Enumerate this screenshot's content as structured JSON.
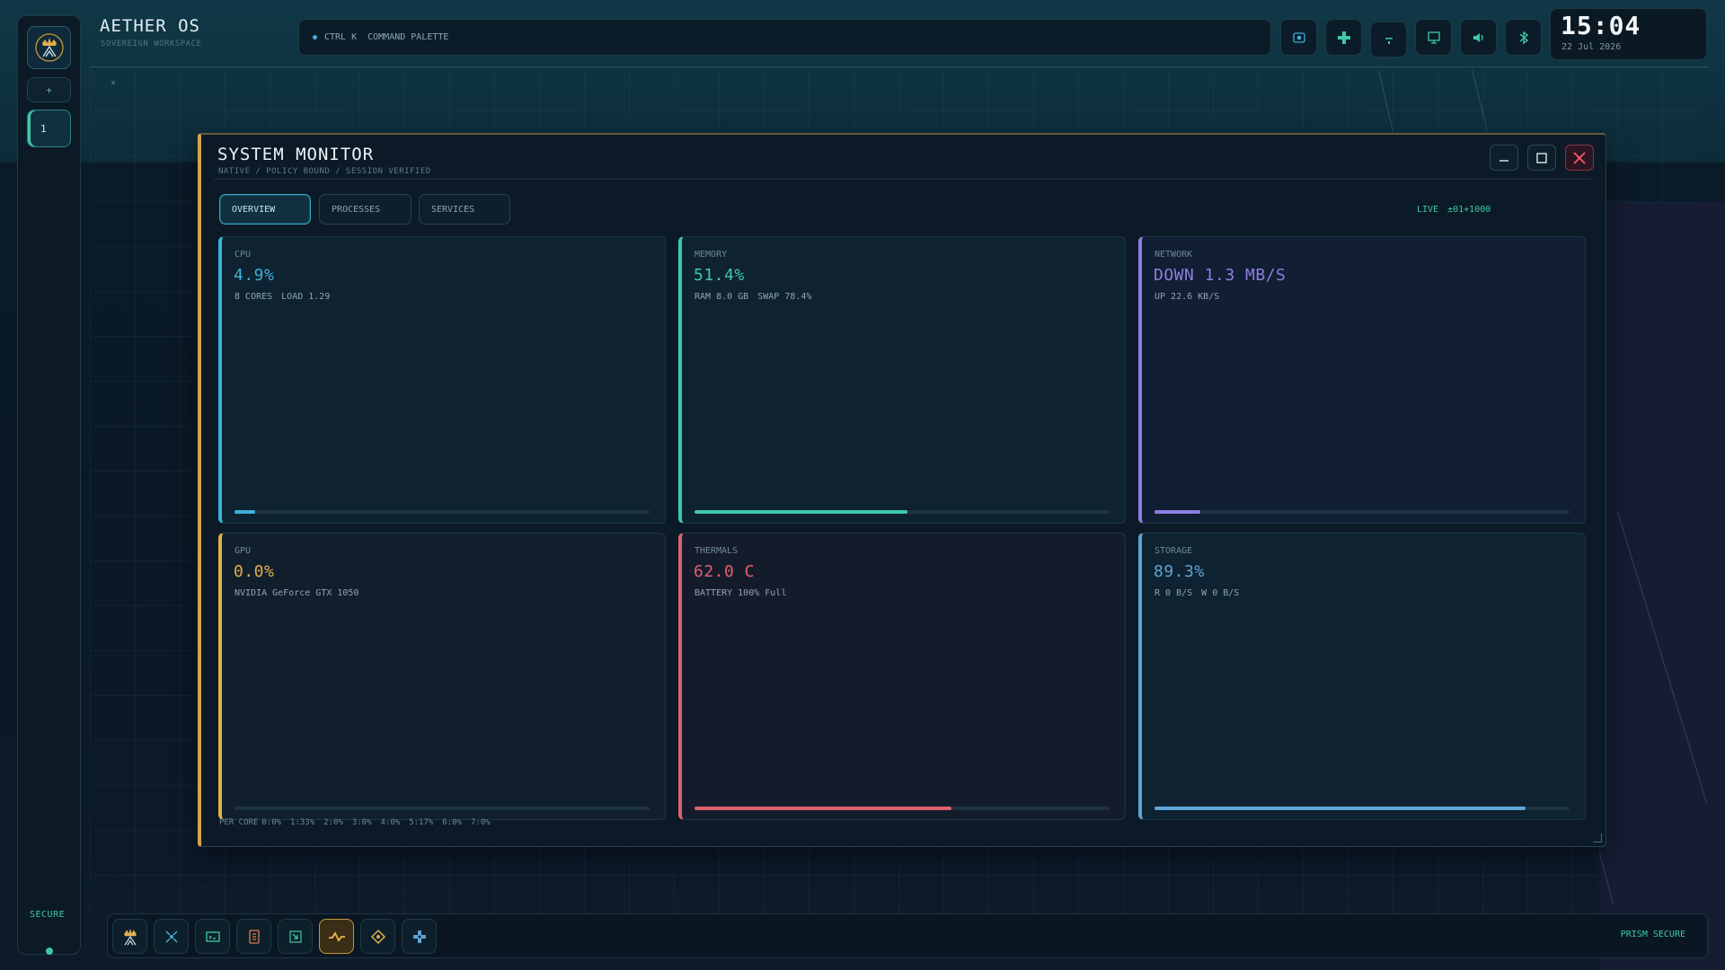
{
  "brand": {
    "title": "AETHER OS",
    "subtitle": "SOVEREIGN WORKSPACE"
  },
  "rail": {
    "add_label": "+",
    "workspace_label": "1",
    "secure_label": "SECURE"
  },
  "palette": {
    "shortcut": "CTRL K",
    "label": "COMMAND PALETTE"
  },
  "tray": {
    "icons": [
      "screenshot-icon",
      "gamepad-icon",
      "pin-icon",
      "display-icon",
      "volume-icon",
      "bluetooth-icon"
    ]
  },
  "clock": {
    "time": "15:04",
    "date": "22 Jul 2026"
  },
  "window": {
    "title": "SYSTEM MONITOR",
    "breadcrumb": "NATIVE  /  POLICY BOUND  /  SESSION VERIFIED",
    "tabs": [
      "OVERVIEW",
      "PROCESSES",
      "SERVICES"
    ],
    "active_tab": "OVERVIEW",
    "live": {
      "label": "LIVE",
      "offset": "±01+1000"
    }
  },
  "cards": {
    "cpu": {
      "label": "CPU",
      "value": "4.9%",
      "detail_1": "8 CORES",
      "detail_2": "LOAD 1.29",
      "usage": 0.05,
      "color": "#3fb0d8"
    },
    "memory": {
      "label": "MEMORY",
      "value": "51.4%",
      "detail_1": "RAM 8.0 GB",
      "detail_2": "SWAP 78.4%",
      "usage": 0.514,
      "color": "#3ec9a7"
    },
    "network": {
      "label": "NETWORK",
      "value": "DOWN 1.3 MB/S",
      "detail_1": "UP 22.6 KB/S",
      "detail_2": "",
      "usage": 0.11,
      "color": "#8d7fe0"
    },
    "gpu": {
      "label": "GPU",
      "value": "0.0%",
      "detail_1": "NVIDIA GeForce GTX 1050",
      "detail_2": "",
      "usage": 0.0,
      "color": "#e0ae4a"
    },
    "thermals": {
      "label": "THERMALS",
      "value": "62.0 C",
      "detail_1": "BATTERY 100% Full",
      "detail_2": "",
      "usage": 0.62,
      "color": "#e0606e"
    },
    "storage": {
      "label": "STORAGE",
      "value": "89.3%",
      "detail_1": "R 0 B/S",
      "detail_2": "W 0 B/S",
      "usage": 0.893,
      "color": "#5fa4d6"
    }
  },
  "per_core": {
    "label": "PER CORE",
    "cores": [
      "0:0%",
      "1:33%",
      "2:0%",
      "3:0%",
      "4:0%",
      "5:17%",
      "6:0%",
      "7:0%"
    ]
  },
  "dock": {
    "apps": [
      "crown-logo-icon",
      "network-icon",
      "terminal-icon",
      "files-icon",
      "editor-icon",
      "monitor-icon",
      "diamond-icon",
      "settings-icon"
    ],
    "active_app": "monitor-icon",
    "status": "PRISM SECURE"
  }
}
